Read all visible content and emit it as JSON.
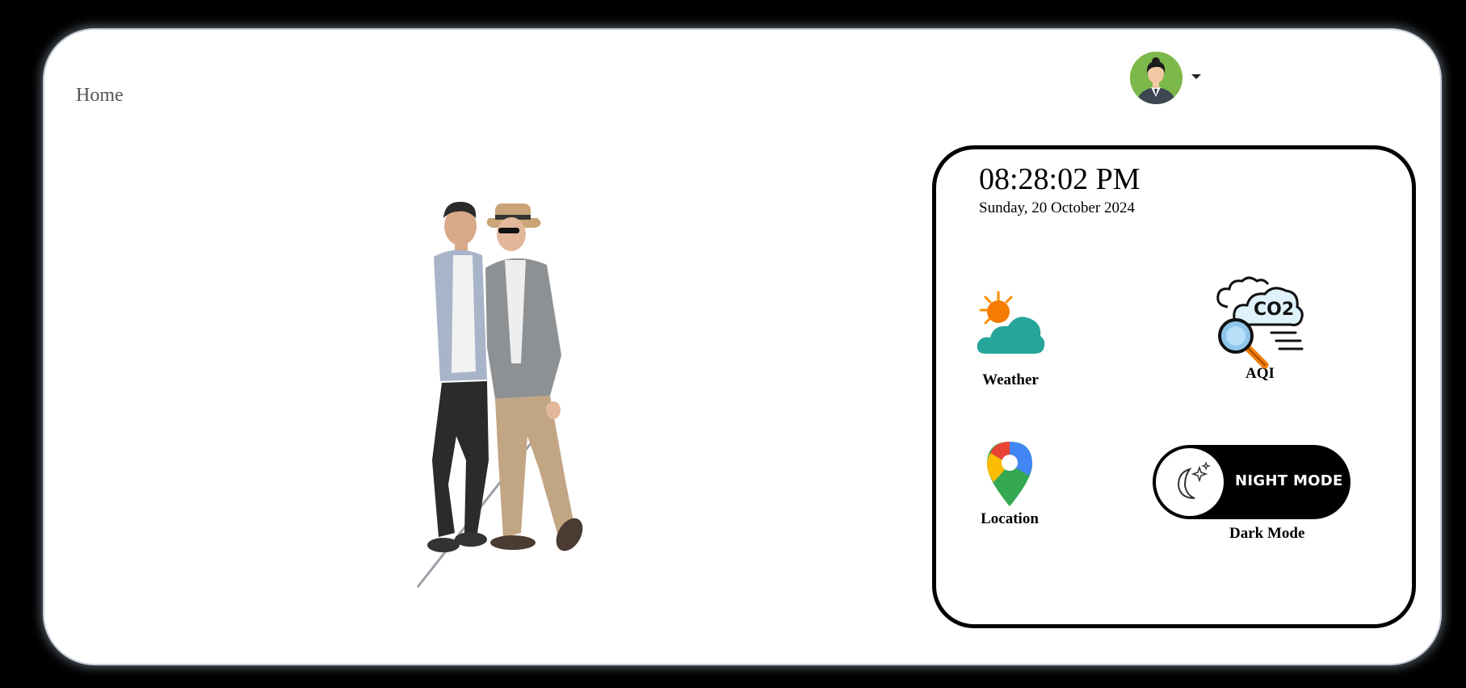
{
  "nav": {
    "home_label": "Home"
  },
  "user": {
    "avatar_icon": "user-avatar-icon",
    "menu_icon": "caret-down-icon"
  },
  "clock": {
    "time": "08:28:02 PM",
    "date": "Sunday, 20 October 2024"
  },
  "tiles": {
    "weather": {
      "label": "Weather",
      "icon": "weather-sun-cloud-icon"
    },
    "aqi": {
      "label": "AQI",
      "icon": "co2-magnifier-icon",
      "icon_text": "CO2"
    },
    "location": {
      "label": "Location",
      "icon": "map-pin-icon"
    }
  },
  "night_mode": {
    "toggle_text": "NIGHT MODE",
    "label": "Dark Mode",
    "icon": "moon-stars-icon"
  },
  "colors": {
    "cloud": "#26a69a",
    "sun": "#ff8c00",
    "toggle_bg": "#000000",
    "avatar_bg": "#7cb84a"
  }
}
